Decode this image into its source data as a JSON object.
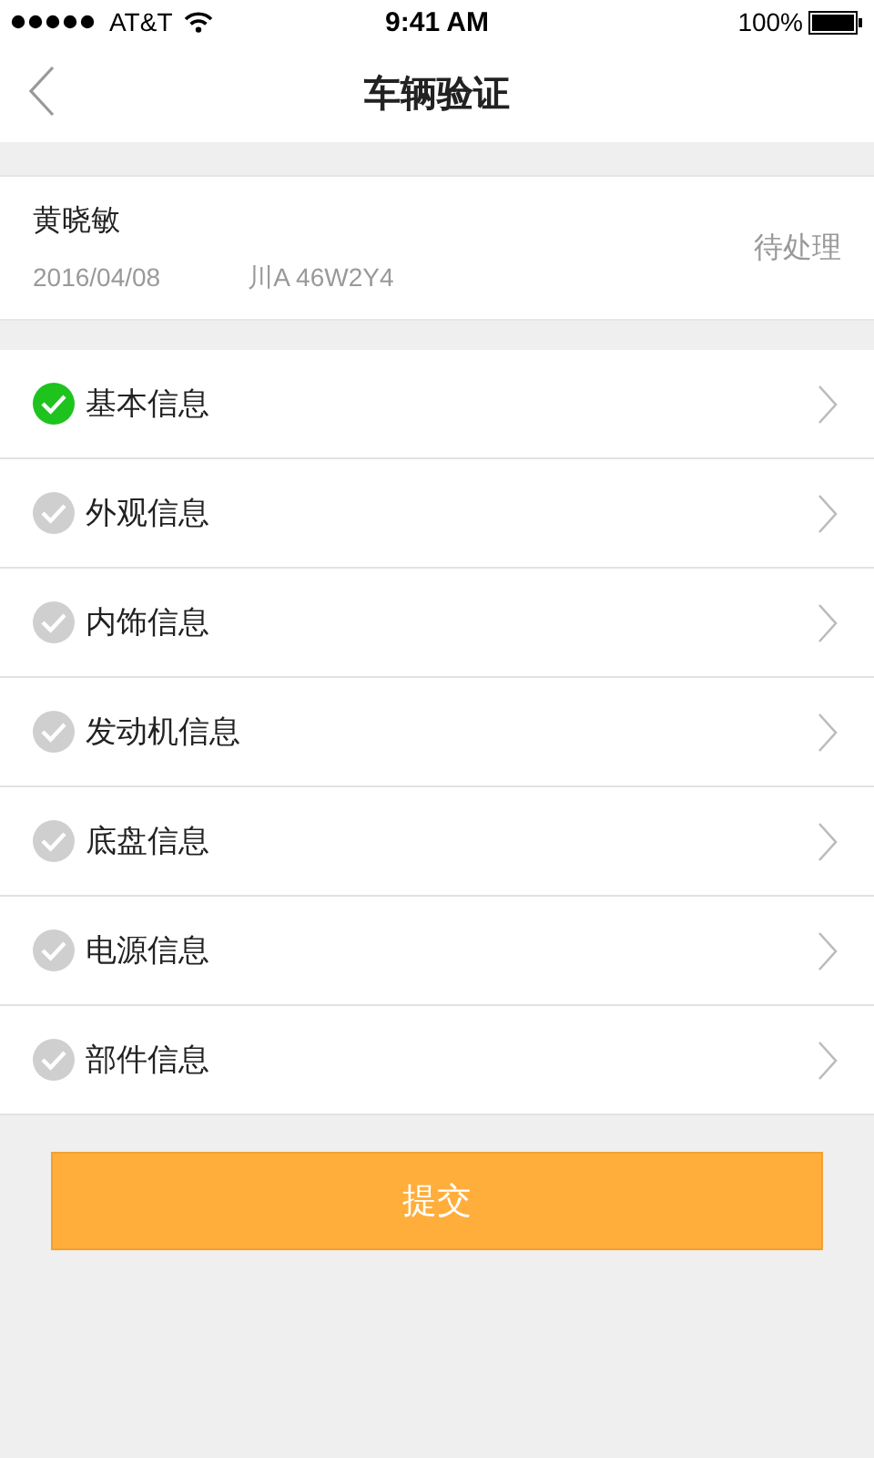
{
  "status_bar": {
    "carrier": "AT&T",
    "time": "9:41 AM",
    "battery": "100%"
  },
  "nav": {
    "title": "车辆验证"
  },
  "record": {
    "name": "黄晓敏",
    "date": "2016/04/08",
    "plate": "川A 46W2Y4",
    "status": "待处理"
  },
  "sections": [
    {
      "label": "基本信息",
      "checked": true
    },
    {
      "label": "外观信息",
      "checked": false
    },
    {
      "label": "内饰信息",
      "checked": false
    },
    {
      "label": "发动机信息",
      "checked": false
    },
    {
      "label": "底盘信息",
      "checked": false
    },
    {
      "label": "电源信息",
      "checked": false
    },
    {
      "label": "部件信息",
      "checked": false
    }
  ],
  "submit": {
    "label": "提交"
  }
}
